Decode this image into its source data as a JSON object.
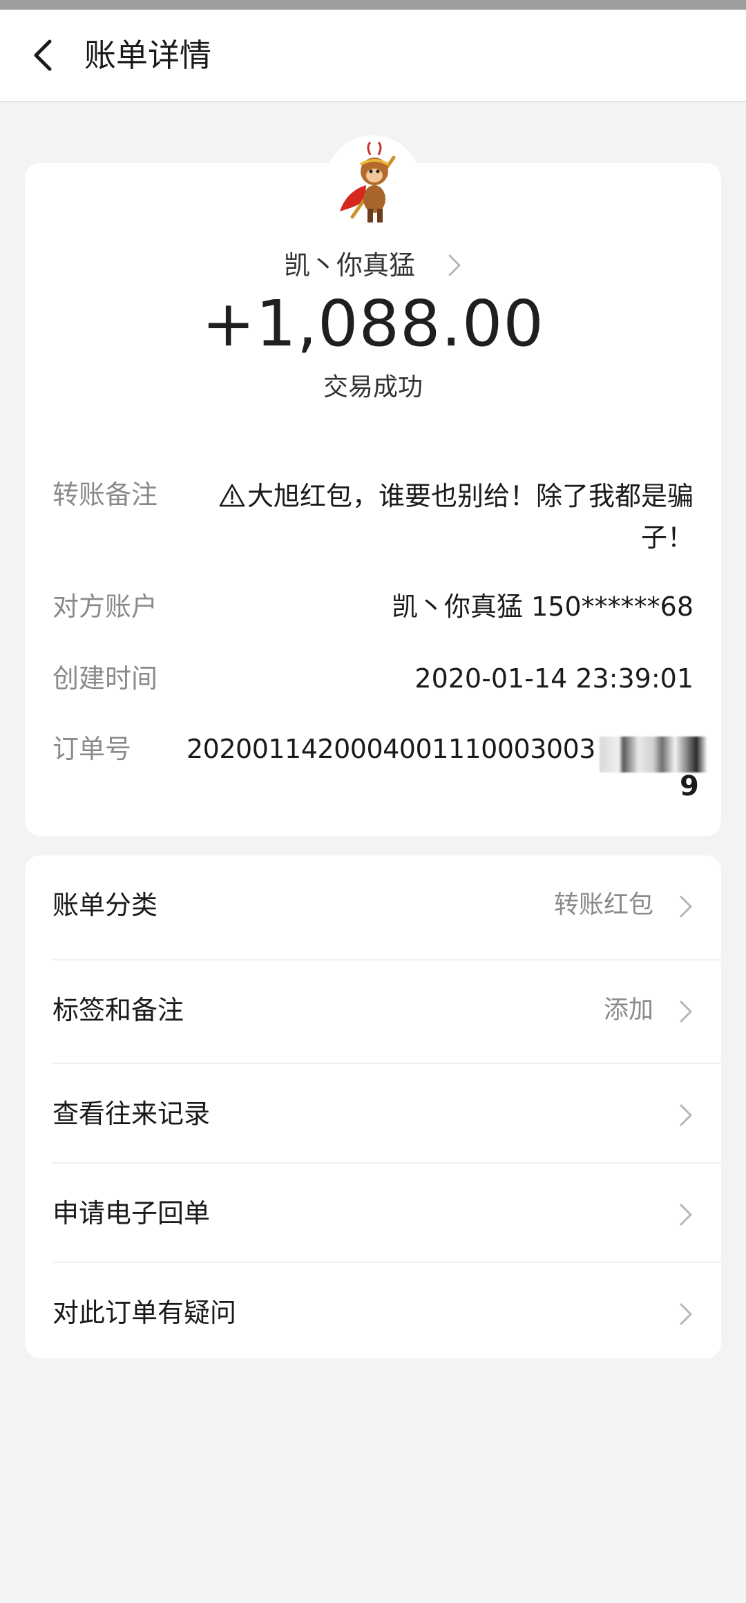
{
  "nav": {
    "title": "账单详情"
  },
  "payer": {
    "name": "凯丶你真猛",
    "avatar": "monkey-king-avatar"
  },
  "transaction": {
    "amount": "+1,088.00",
    "status": "交易成功"
  },
  "details": {
    "remark_label": "转账备注",
    "remark_value": "大旭红包，谁要也别给！除了我都是骗子！",
    "account_label": "对方账户",
    "account_value": "凯丶你真猛 150******68",
    "time_label": "创建时间",
    "time_value": "2020-01-14 23:39:01",
    "order_label": "订单号",
    "order_value": "2020011420004001110003003",
    "order_tail": "9"
  },
  "menu": [
    {
      "label": "账单分类",
      "value": "转账红包"
    },
    {
      "label": "标签和备注",
      "value": "添加"
    },
    {
      "label": "查看往来记录",
      "value": ""
    },
    {
      "label": "申请电子回单",
      "value": ""
    },
    {
      "label": "对此订单有疑问",
      "value": ""
    }
  ],
  "colors": {
    "background": "#f3f3f3",
    "card": "#ffffff",
    "label_gray": "#8a8a8a",
    "text_dark": "#1a1a1a"
  },
  "icons": {
    "back": "chevron-left-icon",
    "chevron": "chevron-right-icon",
    "warning": "warning-triangle-icon"
  }
}
